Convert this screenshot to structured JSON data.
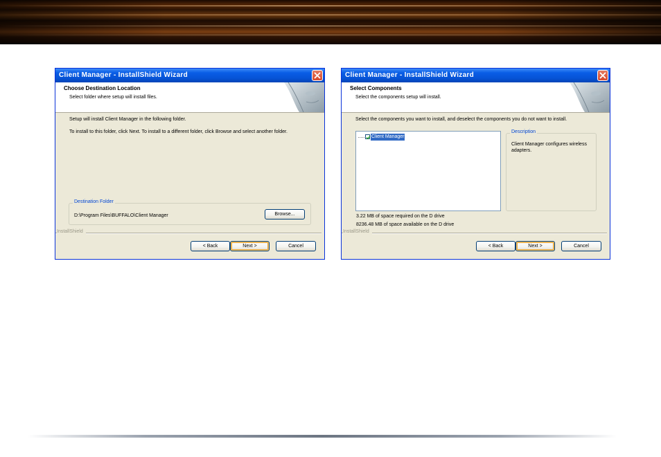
{
  "dialogs": {
    "left": {
      "title": "Client Manager - InstallShield Wizard",
      "header_title": "Choose Destination Location",
      "header_subtitle": "Select folder where setup will install files.",
      "intro": "Setup will install Client Manager in the following folder.",
      "instructions": "To install to this folder, click Next. To install to a different folder, click Browse and select another folder.",
      "group_label": "Destination Folder",
      "folder_path": "D:\\Program Files\\BUFFALO\\Client Manager",
      "browse_label": "Browse...",
      "brand_label": "InstallShield",
      "back_label": "< Back",
      "next_label": "Next >",
      "cancel_label": "Cancel"
    },
    "right": {
      "title": "Client Manager - InstallShield Wizard",
      "header_title": "Select Components",
      "header_subtitle": "Select the components setup will install.",
      "intro": "Select the components you want to install, and deselect the components you do not want to install.",
      "component_label": "Client Manager",
      "component_checked": true,
      "description_label": "Description",
      "description_text": "Client Manager configures wireless adapters.",
      "space_required": "3.22 MB of space required on the D drive",
      "space_available": "8236.48 MB of space available on the D drive",
      "brand_label": "InstallShield",
      "back_label": "< Back",
      "next_label": "Next >",
      "cancel_label": "Cancel"
    }
  },
  "colors": {
    "titlebar_blue": "#0a5ee6",
    "dialog_bg": "#ece9d8",
    "group_label_blue": "#0046d5",
    "selection_blue": "#316ac5",
    "close_red": "#d8492c"
  },
  "icons": [
    "close-icon",
    "checkmark-icon",
    "wizard-header-art"
  ]
}
